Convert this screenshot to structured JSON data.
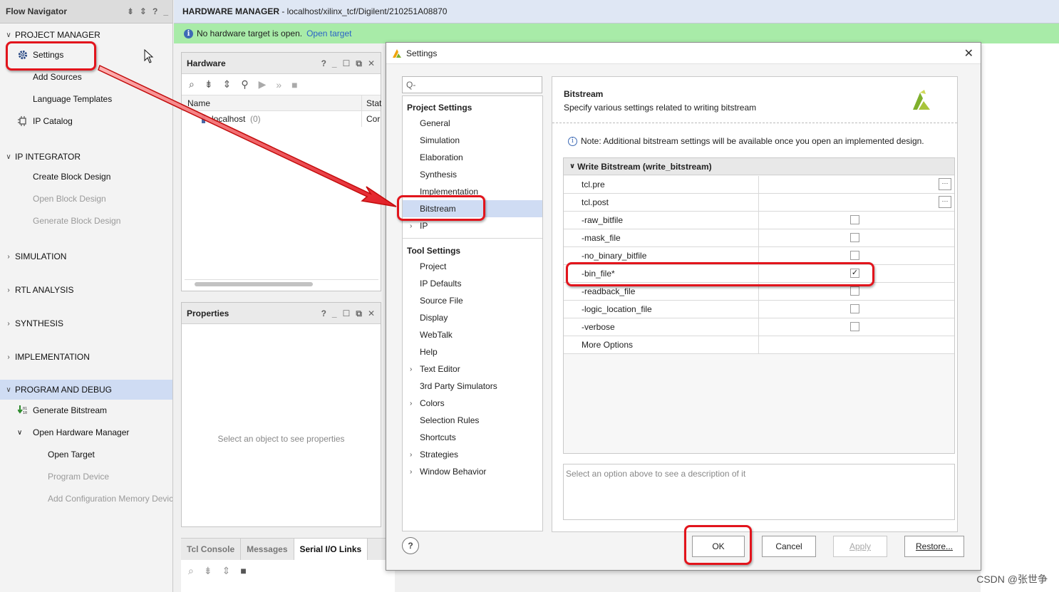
{
  "flow_navigator": {
    "title": "Flow Navigator",
    "sections": [
      {
        "label": "PROJECT MANAGER",
        "items": [
          "Settings",
          "Add Sources",
          "Language Templates",
          "IP Catalog"
        ]
      },
      {
        "label": "IP INTEGRATOR",
        "items": [
          "Create Block Design",
          "Open Block Design",
          "Generate Block Design"
        ]
      },
      {
        "label": "SIMULATION"
      },
      {
        "label": "RTL ANALYSIS"
      },
      {
        "label": "SYNTHESIS"
      },
      {
        "label": "IMPLEMENTATION"
      },
      {
        "label": "PROGRAM AND DEBUG",
        "items": [
          "Generate Bitstream",
          "Open Hardware Manager",
          "Open Target",
          "Program Device",
          "Add Configuration Memory Device"
        ]
      }
    ]
  },
  "hw_manager": {
    "title_bold": "HARDWARE MANAGER",
    "title_rest": " - localhost/xilinx_tcf/Digilent/210251A08870",
    "banner_text": "No hardware target is open.",
    "banner_link": "Open target"
  },
  "hardware_panel": {
    "title": "Hardware",
    "col_name": "Name",
    "col_status": "Stat",
    "row_name": "localhost",
    "row_count": "(0)",
    "row_status": "Cor"
  },
  "properties_panel": {
    "title": "Properties",
    "empty_text": "Select an object to see properties"
  },
  "bottom_tabs": [
    "Tcl Console",
    "Messages",
    "Serial I/O Links"
  ],
  "dialog": {
    "title": "Settings",
    "search_placeholder": "Q-",
    "tree": {
      "project_settings_label": "Project Settings",
      "project_items": [
        "General",
        "Simulation",
        "Elaboration",
        "Synthesis",
        "Implementation",
        "Bitstream",
        "IP"
      ],
      "tool_settings_label": "Tool Settings",
      "tool_items": [
        "Project",
        "IP Defaults",
        "Source File",
        "Display",
        "WebTalk",
        "Help",
        "Text Editor",
        "3rd Party Simulators",
        "Colors",
        "Selection Rules",
        "Shortcuts",
        "Strategies",
        "Window Behavior"
      ]
    },
    "content": {
      "title": "Bitstream",
      "description": "Specify various settings related to writing bitstream",
      "note": "Note: Additional bitstream settings will be available once you open an implemented design.",
      "group_label": "Write Bitstream (write_bitstream)",
      "options": [
        {
          "name": "tcl.pre",
          "type": "file"
        },
        {
          "name": "tcl.post",
          "type": "file"
        },
        {
          "name": "-raw_bitfile",
          "type": "checkbox",
          "checked": false
        },
        {
          "name": "-mask_file",
          "type": "checkbox",
          "checked": false
        },
        {
          "name": "-no_binary_bitfile",
          "type": "checkbox",
          "checked": false
        },
        {
          "name": "-bin_file*",
          "type": "checkbox",
          "checked": true
        },
        {
          "name": "-readback_file",
          "type": "checkbox",
          "checked": false
        },
        {
          "name": "-logic_location_file",
          "type": "checkbox",
          "checked": false
        },
        {
          "name": "-verbose",
          "type": "checkbox",
          "checked": false
        },
        {
          "name": "More Options",
          "type": "text"
        }
      ],
      "description_placeholder": "Select an option above to see a description of it"
    },
    "buttons": {
      "ok": "OK",
      "cancel": "Cancel",
      "apply": "Apply",
      "restore": "Restore...",
      "help": "?"
    }
  },
  "watermark": "CSDN @张世争",
  "colors": {
    "annotation_red": "#e2141c",
    "selection": "#cfdcf3",
    "banner_green": "#a8eba8",
    "link_blue": "#2a63c7"
  }
}
